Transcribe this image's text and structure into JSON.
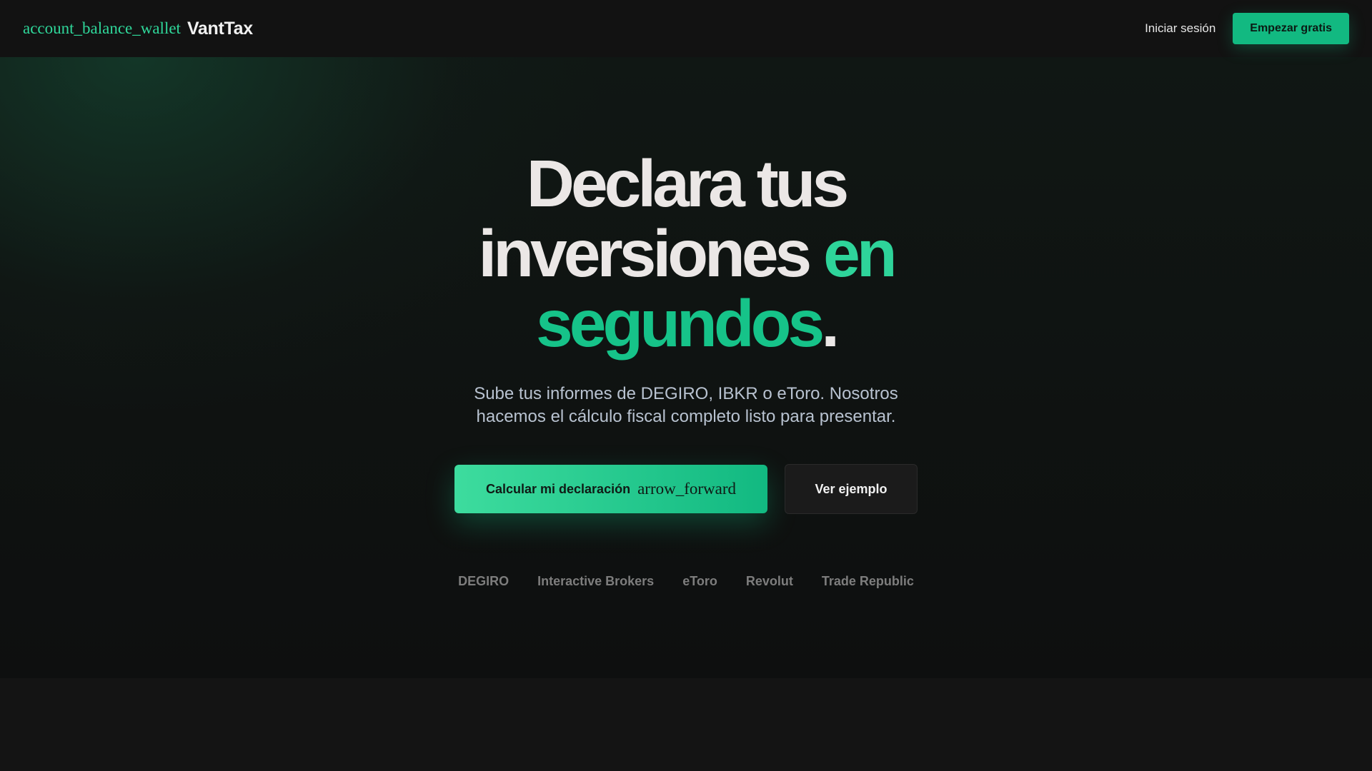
{
  "nav": {
    "brand_icon": "account_balance_wallet",
    "brand_name": "VantTax",
    "login_label": "Iniciar sesión",
    "cta_label": "Empezar gratis"
  },
  "hero": {
    "headline_line1": "Declara tus",
    "headline_line2_main": "inversiones ",
    "headline_line2_accent": "en",
    "headline_line3_accent": "segundos",
    "headline_line3_end": ".",
    "subtitle": "Sube tus informes de DEGIRO, IBKR o eToro. Nosotros hacemos el cálculo fiscal completo listo para presentar.",
    "primary_button_label": "Calcular mi declaración",
    "primary_button_icon": "arrow_forward",
    "secondary_button_label": "Ver ejemplo",
    "brokers": [
      "DEGIRO",
      "Interactive Brokers",
      "eToro",
      "Revolut",
      "Trade Republic"
    ]
  },
  "colors": {
    "accent": "#2ed49a",
    "accent_deep": "#12b981",
    "background": "#121212"
  }
}
